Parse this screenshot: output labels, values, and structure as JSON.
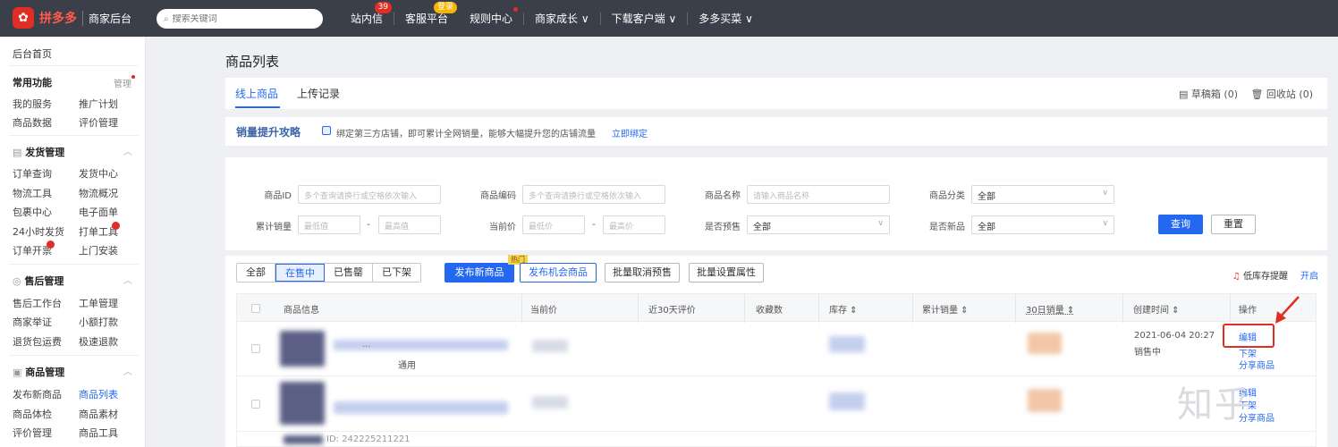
{
  "topbar": {
    "brand": "拼多多",
    "brand_sub": "商家后台",
    "search_placeholder": "搜索关键词",
    "nav": [
      {
        "label": "站内信",
        "badge": "39"
      },
      {
        "label": "客服平台",
        "badge": "登录"
      },
      {
        "label": "规则中心"
      },
      {
        "label": "商家成长 ∨"
      },
      {
        "label": "下载客户端 ∨"
      },
      {
        "label": "多多买菜 ∨"
      }
    ]
  },
  "sidebar": {
    "home": "后台首页",
    "common": "常用功能",
    "manage": "管理",
    "common_items": [
      "我的服务",
      "推广计划",
      "商品数据",
      "评价管理"
    ],
    "shipping": "发货管理",
    "shipping_items": [
      "订单查询",
      "发货中心",
      "物流工具",
      "物流概况",
      "包裹中心",
      "电子面单",
      "24小时发货",
      "打单工具",
      "订单开票",
      "上门安装"
    ],
    "aftersale": "售后管理",
    "aftersale_items": [
      "售后工作台",
      "工单管理",
      "商家举证",
      "小额打款",
      "退货包运费",
      "极速退款"
    ],
    "goods": "商品管理",
    "goods_items": [
      "发布新商品",
      "商品列表",
      "商品体检",
      "商品素材",
      "评价管理",
      "商品工具"
    ]
  },
  "page": {
    "title": "商品列表",
    "tab_online": "线上商品",
    "tab_upload": "上传记录",
    "drafts": "草稿箱 (0)",
    "recycle": "回收站 (0)"
  },
  "promo": {
    "title": "销量提升攻略",
    "text": "绑定第三方店铺，即可累计全网销量，能够大幅提升您的店铺流量",
    "link": "立即绑定"
  },
  "filters": {
    "goods_id": "商品ID",
    "goods_id_ph": "多个查询请换行或空格依次输入",
    "goods_code": "商品编码",
    "goods_code_ph": "多个查询请换行或空格依次输入",
    "goods_name": "商品名称",
    "goods_name_ph": "请输入商品名称",
    "category": "商品分类",
    "category_val": "全部",
    "sales": "累计销量",
    "min_ph": "最低值",
    "max_ph": "最高值",
    "price": "当前价",
    "min_price_ph": "最低价",
    "max_price_ph": "最高价",
    "presale": "是否预售",
    "presale_val": "全部",
    "isnew": "是否新品",
    "isnew_val": "全部",
    "query": "查询",
    "reset": "重置",
    "dash": "-"
  },
  "list": {
    "seg": [
      "全部",
      "在售中",
      "已售罄",
      "已下架"
    ],
    "publish": "发布新商品",
    "hot": "热门",
    "publish_opp": "发布机会商品",
    "cancel_presale": "批量取消预售",
    "batch_attr": "批量设置属性",
    "low_stock": "低库存提醒",
    "open": "开启",
    "headers": [
      "商品信息",
      "当前价",
      "近30天评价",
      "收藏数",
      "库存 ⇕",
      "累计销量 ⇕",
      "30日销量 ⇕",
      "创建时间 ⇕",
      "操作"
    ],
    "row1": {
      "partial_title": "...",
      "partial_tag": "通用",
      "created": "2021-06-04 20:27",
      "status": "销售中",
      "edit": "编辑",
      "offshelf": "下架",
      "share": "分享商品"
    },
    "row2": {
      "edit": "编辑",
      "offshelf": "下架",
      "share": "分享商品"
    },
    "row3": {
      "partial_id": "ID: 242225211221"
    }
  },
  "watermark": "知乎"
}
